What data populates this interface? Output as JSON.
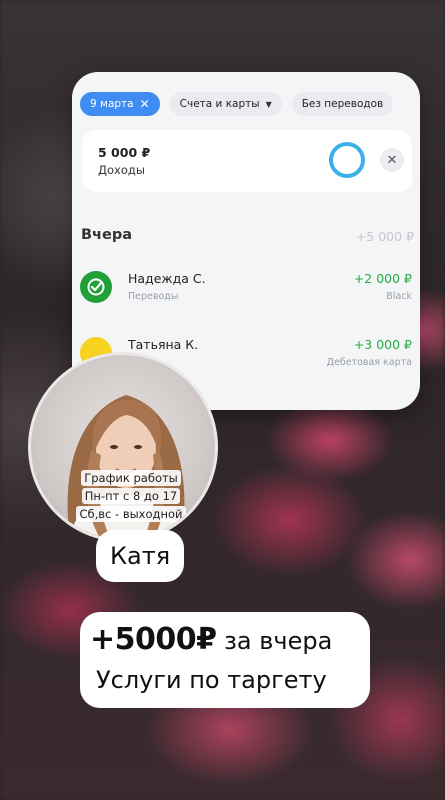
{
  "filters": {
    "date_chip": "9 марта",
    "date_chip_close": "✕",
    "accounts_chip": "Счета и карты",
    "accounts_chip_arrow": "▼",
    "transfers_chip": "Без переводов"
  },
  "income": {
    "amount": "5 000 ₽",
    "label": "Доходы",
    "close": "✕"
  },
  "day": {
    "title": "Вчера",
    "total": "+5 000 ₽"
  },
  "transactions": [
    {
      "name": "Надежда С.",
      "category": "Переводы",
      "amount": "+2 000 ₽",
      "sub": "Black",
      "icon": "sber-check-icon",
      "icon_color": "#21a038"
    },
    {
      "name": "Татьяна К.",
      "category": "",
      "amount": "+3 000 ₽",
      "sub": "Дебетовая карта",
      "icon": "yellow-bank-icon",
      "icon_color": "#f7d21e"
    }
  ],
  "avatar": {
    "caption_line1": "График работы",
    "caption_line2": "Пн-пт с 8 до 17",
    "caption_line3": "Сб,вс - выходной"
  },
  "name_label": "Катя",
  "caption": {
    "line1_big": "+5000₽",
    "line1_rest": " за вчера",
    "line2": "Услуги по таргету"
  },
  "colors": {
    "accent_blue": "#3f8df2",
    "ring": "#3cb1e8",
    "positive": "#2ca94a"
  }
}
